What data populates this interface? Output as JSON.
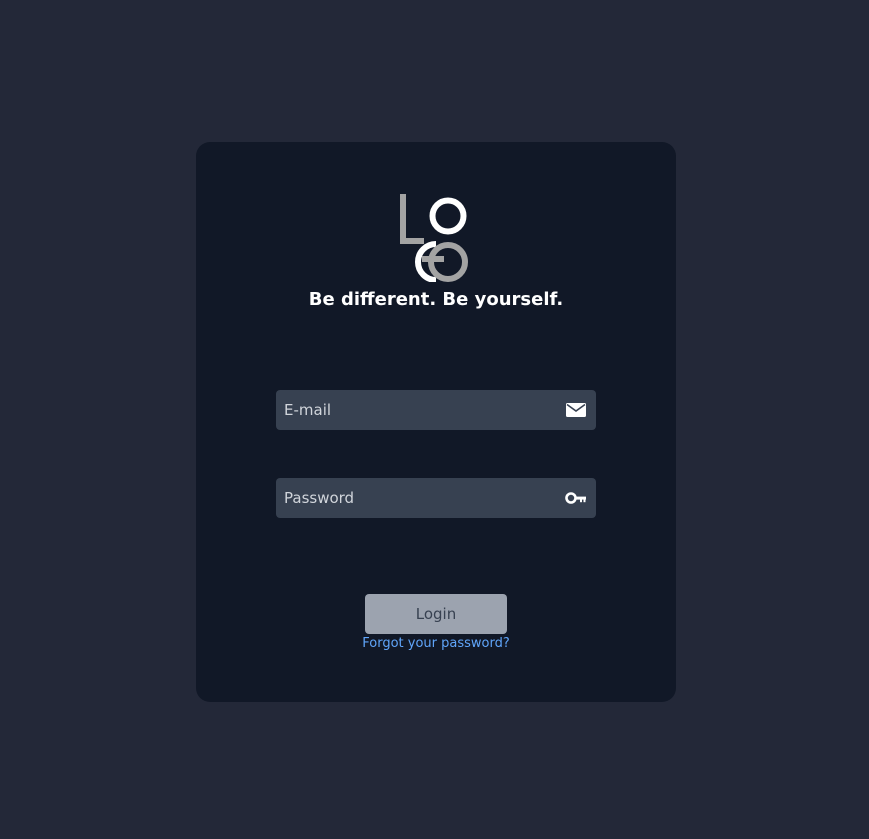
{
  "logo": {
    "alt": "LOGO",
    "colors": {
      "primary": "#ffffff",
      "secondary": "#a3a3a3"
    }
  },
  "tagline": "Be different. Be yourself.",
  "form": {
    "email": {
      "placeholder": "E-mail",
      "value": "",
      "icon": "envelope-icon"
    },
    "password": {
      "placeholder": "Password",
      "value": "",
      "icon": "key-icon"
    },
    "login_label": "Login",
    "forgot_label": "Forgot your password?"
  },
  "colors": {
    "page_background": "#232838",
    "card_background": "#111827",
    "input_background": "#374151",
    "button_background": "#9ca3af",
    "link": "#60a5fa"
  }
}
